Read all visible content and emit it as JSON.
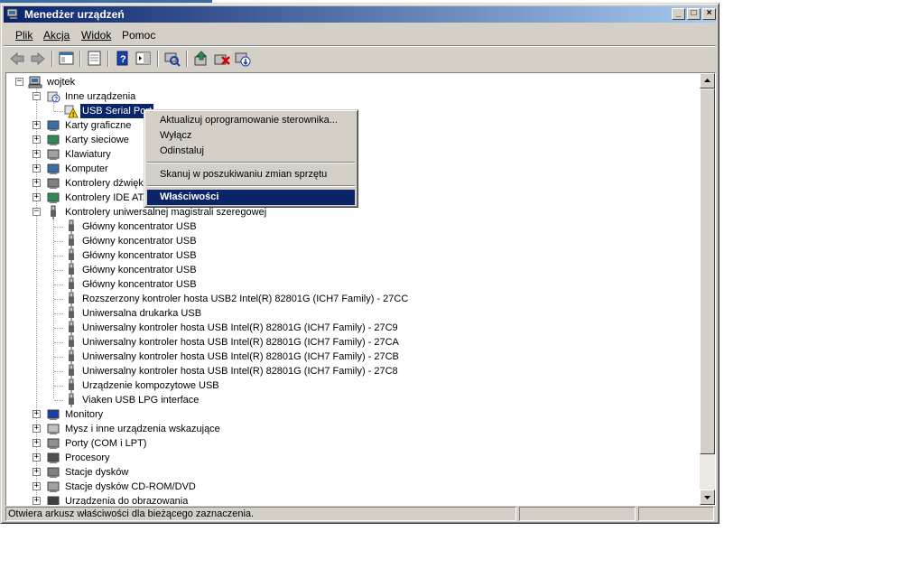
{
  "window": {
    "title": "Menedżer urządzeń",
    "controls": {
      "minimize": "_",
      "maximize": "□",
      "close": "×"
    }
  },
  "menubar": {
    "items": [
      {
        "label": "Plik"
      },
      {
        "label": "Akcja"
      },
      {
        "label": "Widok"
      },
      {
        "label": "Pomoc"
      }
    ]
  },
  "toolbar": {
    "icons": [
      "back-arrow-icon",
      "forward-arrow-icon",
      "console-tree-icon",
      "properties-icon",
      "help-icon",
      "show-hide-icon",
      "scan-hardware-icon",
      "update-driver-icon",
      "uninstall-icon",
      "disable-icon"
    ]
  },
  "tree": {
    "root": "wojtek",
    "categories": [
      {
        "label": "Inne urządzenia",
        "expanded": true,
        "children": [
          "USB Serial Port"
        ]
      },
      {
        "label": "Karty graficzne"
      },
      {
        "label": "Karty sieciowe"
      },
      {
        "label": "Klawiatury"
      },
      {
        "label": "Komputer"
      },
      {
        "label": "Kontrolery dźwięku, wideo i gier"
      },
      {
        "label": "Kontrolery IDE ATA/ATAPI"
      },
      {
        "label": "Kontrolery uniwersalnej magistrali szeregowej",
        "expanded": true,
        "children": [
          "Główny koncentrator USB",
          "Główny koncentrator USB",
          "Główny koncentrator USB",
          "Główny koncentrator USB",
          "Główny koncentrator USB",
          "Rozszerzony kontroler hosta USB2 Intel(R) 82801G (ICH7 Family) - 27CC",
          "Uniwersalna drukarka USB",
          "Uniwersalny kontroler hosta USB Intel(R) 82801G (ICH7 Family) - 27C9",
          "Uniwersalny kontroler hosta USB Intel(R) 82801G (ICH7 Family) - 27CA",
          "Uniwersalny kontroler hosta USB Intel(R) 82801G (ICH7 Family) - 27CB",
          "Uniwersalny kontroler hosta USB Intel(R) 82801G (ICH7 Family) - 27C8",
          "Urządzenie kompozytowe USB",
          "Viaken USB LPG interface"
        ]
      },
      {
        "label": "Monitory"
      },
      {
        "label": "Mysz i inne urządzenia wskazujące"
      },
      {
        "label": "Porty (COM i LPT)"
      },
      {
        "label": "Procesory"
      },
      {
        "label": "Stacje dysków"
      },
      {
        "label": "Stacje dysków CD-ROM/DVD"
      },
      {
        "label": "Urządzenia do obrazowania"
      }
    ]
  },
  "context_menu": {
    "items": [
      {
        "label": "Aktualizuj oprogramowanie sterownika..."
      },
      {
        "label": "Wyłącz"
      },
      {
        "label": "Odinstaluj"
      },
      {
        "label": "Skanuj w poszukiwaniu zmian sprzętu"
      },
      {
        "label": "Właściwości"
      }
    ]
  },
  "statusbar": {
    "text": "Otwiera arkusz właściwości dla bieżącego zaznaczenia."
  },
  "colors": {
    "title_gradient_start": "#0a246a",
    "title_gradient_end": "#a6caf0",
    "selection": "#0a246a",
    "face": "#d4d0c8"
  }
}
